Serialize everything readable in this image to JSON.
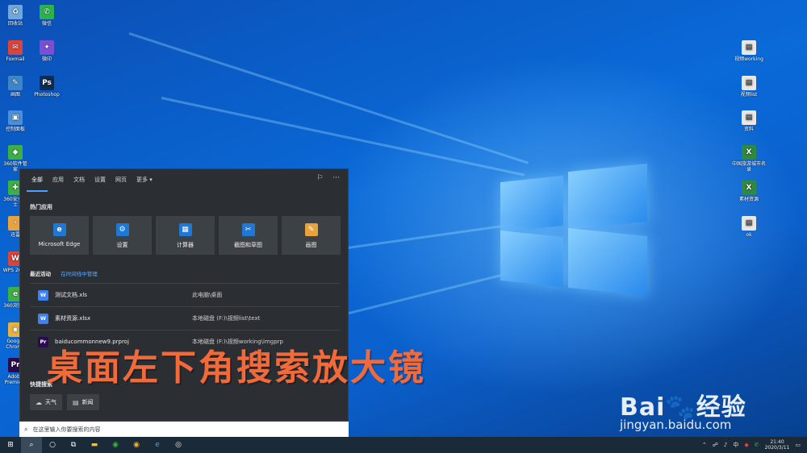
{
  "desktop": {
    "left_icons": [
      {
        "label": "回收站",
        "color": "#6fa8dc",
        "glyph": "♻"
      },
      {
        "label": "微信",
        "color": "#2bb24c",
        "glyph": "✆"
      },
      {
        "label": "Foxmail",
        "color": "#d9443b",
        "glyph": "✉"
      },
      {
        "label": "微印",
        "color": "#7b4fd1",
        "glyph": "✦"
      },
      {
        "label": "画图",
        "color": "#3d85c6",
        "glyph": "✎"
      },
      {
        "label": "Photoshop",
        "color": "#0c2c57",
        "glyph": "Ps"
      },
      {
        "label": "控制面板",
        "color": "#4a90d9",
        "glyph": "▣"
      },
      {
        "label": "360软件管家",
        "color": "#3cb043",
        "glyph": "◆"
      },
      {
        "label": "360安全卫士",
        "color": "#3cb043",
        "glyph": "✚"
      },
      {
        "label": "迅雷",
        "color": "#e8a33d",
        "glyph": "⚡"
      },
      {
        "label": "WPS 2019",
        "color": "#d9443b",
        "glyph": "W"
      },
      {
        "label": "360浏览器",
        "color": "#3cb043",
        "glyph": "e"
      },
      {
        "label": "Google Chrome",
        "color": "#e8b33d",
        "glyph": "◉"
      },
      {
        "label": "Adobe Premiere",
        "color": "#2a0c4e",
        "glyph": "Pr"
      }
    ],
    "right_icons": [
      {
        "label": "视频working",
        "color": "#e8e8e8",
        "glyph": "▤"
      },
      {
        "label": "视频list",
        "color": "#e8e8e8",
        "glyph": "▤"
      },
      {
        "label": "资料",
        "color": "#e8e8e8",
        "glyph": "▤"
      },
      {
        "label": "中国旅游城市名录",
        "color": "#2d8a3e",
        "glyph": "X"
      },
      {
        "label": "素材资源",
        "color": "#2d8a3e",
        "glyph": "X"
      },
      {
        "label": "ok",
        "color": "#e8e8e8",
        "glyph": "▤"
      }
    ]
  },
  "panel": {
    "tabs": [
      "全部",
      "应用",
      "文档",
      "设置",
      "网页",
      "更多"
    ],
    "hot_apps_title": "热门应用",
    "hot_apps": [
      {
        "label": "Microsoft Edge",
        "color": "#1e78d4",
        "glyph": "e"
      },
      {
        "label": "设置",
        "color": "#1e78d4",
        "glyph": "⚙"
      },
      {
        "label": "计算器",
        "color": "#1e78d4",
        "glyph": "▦"
      },
      {
        "label": "截图和草图",
        "color": "#1e78d4",
        "glyph": "✂"
      },
      {
        "label": "画图",
        "color": "#e8a33d",
        "glyph": "✎"
      }
    ],
    "recent_title": "最近活动",
    "recent_link": "在时间线中管理",
    "recent_items": [
      {
        "name": "测试文档.xls",
        "path": "此电脑\\桌面",
        "color": "#3b82f6",
        "glyph": "W"
      },
      {
        "name": "素材资源.xlsx",
        "path": "本地磁盘 (F:)\\视频list\\text",
        "color": "#3b82f6",
        "glyph": "W"
      },
      {
        "name": "baiducommonnew9.prproj",
        "path": "本地磁盘 (F:)\\视频working\\imgprp",
        "color": "#2a0c4e",
        "glyph": "Pr"
      }
    ],
    "quick_title": "快捷搜索",
    "quick_items": [
      {
        "label": "天气",
        "glyph": "☁"
      },
      {
        "label": "新闻",
        "glyph": "▤"
      }
    ]
  },
  "search": {
    "placeholder": "在这里输入你要搜索的内容"
  },
  "caption": "桌面左下角搜索放大镜",
  "watermark": {
    "brand": "Bai🐾经验",
    "url": "jingyan.baidu.com"
  },
  "taskbar": {
    "buttons": [
      {
        "name": "start-icon",
        "glyph": "⊞",
        "color": "#ffffff"
      },
      {
        "name": "search-icon",
        "glyph": "⌕",
        "color": "#ffffff"
      },
      {
        "name": "cortana-icon",
        "glyph": "○",
        "color": "#ffffff"
      },
      {
        "name": "task-view-icon",
        "glyph": "⧉",
        "color": "#ffffff"
      },
      {
        "name": "file-explorer-icon",
        "glyph": "▬",
        "color": "#e8c44a"
      },
      {
        "name": "360-browser-icon",
        "glyph": "◉",
        "color": "#3cb043"
      },
      {
        "name": "chrome-icon",
        "glyph": "◉",
        "color": "#e8b33d"
      },
      {
        "name": "ie-icon",
        "glyph": "e",
        "color": "#4aa3ff"
      },
      {
        "name": "app-icon",
        "glyph": "◎",
        "color": "#e8e8e8"
      }
    ],
    "tray": {
      "ime": "中",
      "time": "21:40",
      "date": "2020/3/11"
    }
  }
}
